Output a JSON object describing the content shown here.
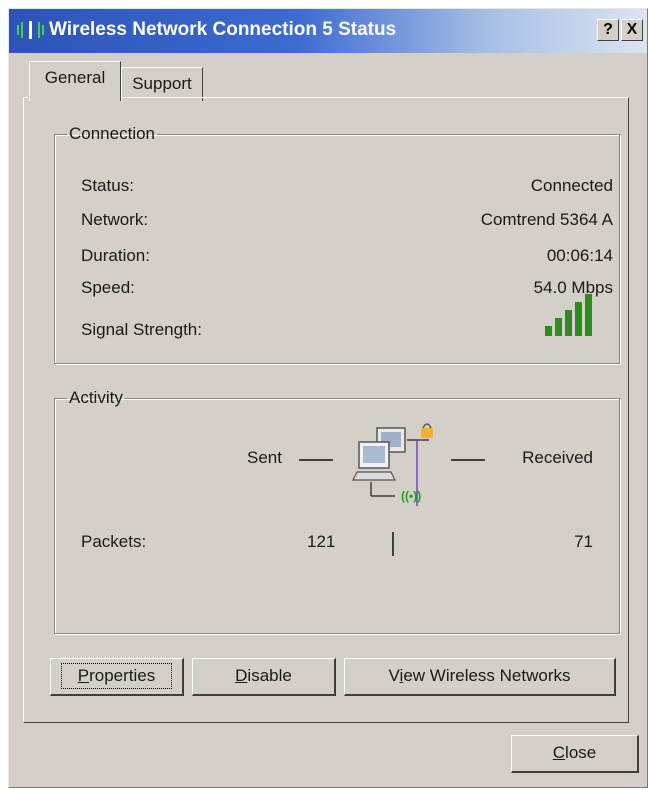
{
  "window": {
    "title": "Wireless Network Connection 5 Status",
    "help_button": "?",
    "close_x": "X"
  },
  "tabs": [
    {
      "label": "General",
      "selected": true
    },
    {
      "label": "Support",
      "selected": false
    }
  ],
  "connection": {
    "legend": "Connection",
    "rows": [
      {
        "label": "Status:",
        "value": "Connected"
      },
      {
        "label": "Network:",
        "value": "Comtrend 5364 A"
      },
      {
        "label": "Duration:",
        "value": "00:06:14"
      },
      {
        "label": "Speed:",
        "value": "54.0 Mbps"
      }
    ],
    "signal_label": "Signal Strength:",
    "signal_bars_lit": 5,
    "signal_bars_total": 5,
    "signal_color": "#2e8b1e"
  },
  "activity": {
    "legend": "Activity",
    "sent_label": "Sent",
    "received_label": "Received",
    "packets_label": "Packets:",
    "packets_sent": "121",
    "packets_received": "71"
  },
  "buttons": {
    "properties": {
      "hotkey": "P",
      "rest": "roperties"
    },
    "disable": {
      "hotkey": "D",
      "rest": "isable"
    },
    "view_networks": {
      "pre": "V",
      "hotkey": "i",
      "rest": "ew Wireless Networks"
    },
    "close": {
      "hotkey": "C",
      "rest": "lose"
    }
  },
  "colors": {
    "titlebar": "#2c54b8",
    "face": "#d4d0c8"
  }
}
